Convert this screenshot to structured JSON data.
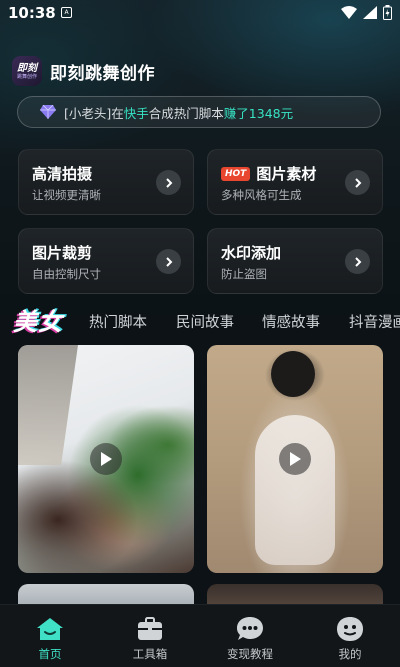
{
  "status_bar": {
    "time": "10:38",
    "sim_icon": "sim-a-icon",
    "icons": [
      "wifi-icon",
      "signal-icon",
      "battery-icon"
    ]
  },
  "header": {
    "logo_text": "即刻",
    "logo_sub": "跳舞创作",
    "title": "即刻跳舞创作"
  },
  "notice": {
    "prefix": "[小老头]在",
    "platform": "快手",
    "middle": "合成热门脚本",
    "earned": "赚了1348元"
  },
  "tools": [
    {
      "title": "高清拍摄",
      "subtitle": "让视频更清晰",
      "badge": ""
    },
    {
      "title": "图片素材",
      "subtitle": "多种风格可生成",
      "badge": "HOT"
    },
    {
      "title": "图片裁剪",
      "subtitle": "自由控制尺寸",
      "badge": ""
    },
    {
      "title": "水印添加",
      "subtitle": "防止盗图",
      "badge": ""
    }
  ],
  "categories": {
    "active": "美女",
    "items": [
      "热门脚本",
      "民间故事",
      "情感故事",
      "抖音漫画"
    ]
  },
  "nav": {
    "items": [
      {
        "label": "首页",
        "icon": "home-icon",
        "active": true
      },
      {
        "label": "工具箱",
        "icon": "toolbox-icon",
        "active": false
      },
      {
        "label": "变现教程",
        "icon": "chat-bubble-icon",
        "active": false
      },
      {
        "label": "我的",
        "icon": "profile-face-icon",
        "active": false
      }
    ]
  },
  "colors": {
    "accent": "#3fe0c6",
    "hot": "#e9462f",
    "background": "#0c1216"
  }
}
